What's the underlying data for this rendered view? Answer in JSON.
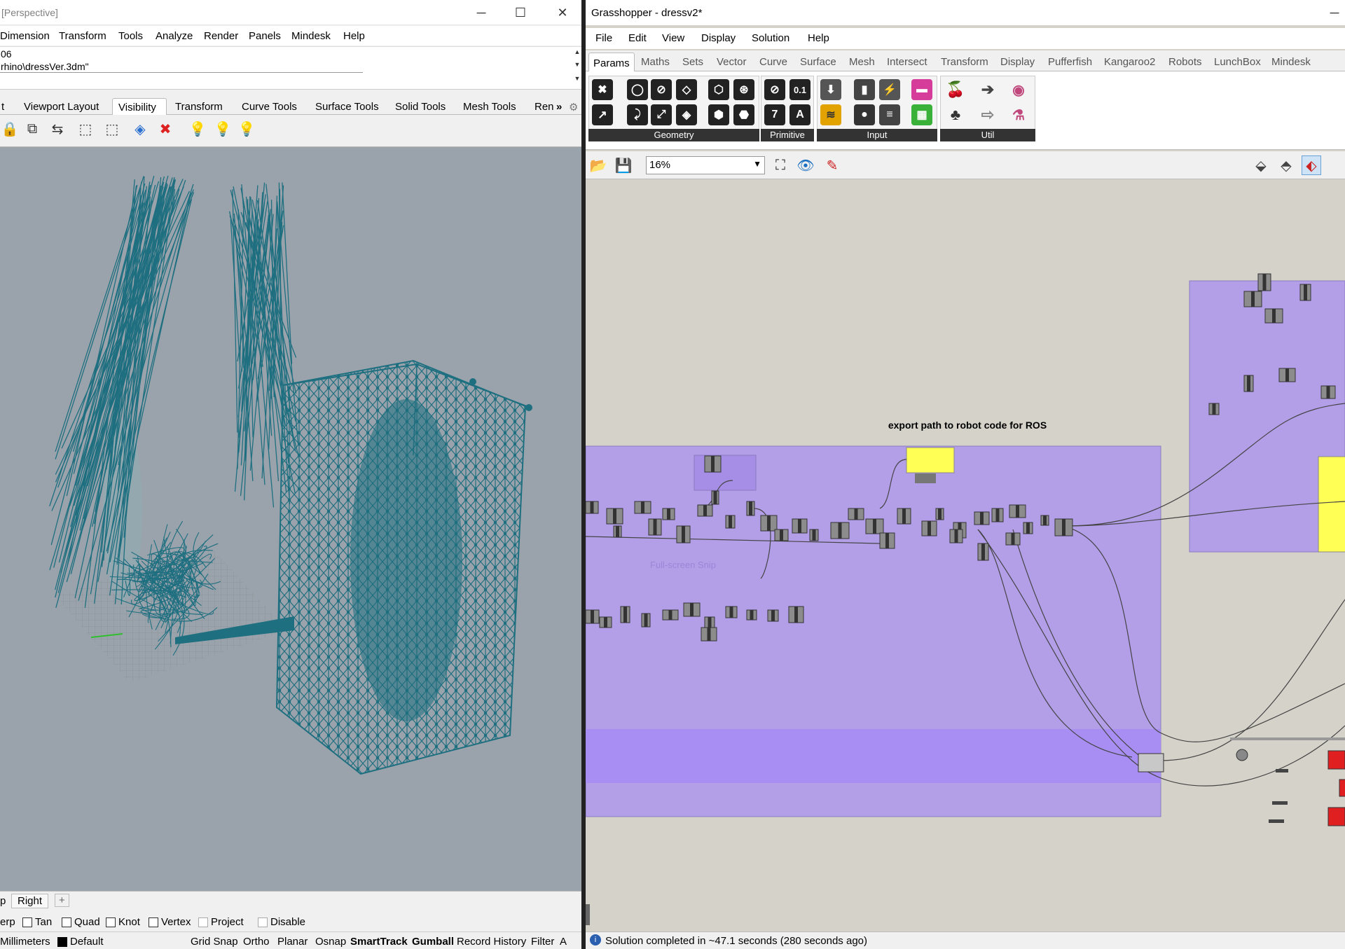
{
  "rhino": {
    "title": "[Perspective]",
    "window_controls": {
      "minimize": "─",
      "maximize": "☐",
      "close": "✕"
    },
    "menu": [
      "Dimension",
      "Transform",
      "Tools",
      "Analyze",
      "Render",
      "Panels",
      "Mindesk",
      "Help"
    ],
    "command_lines": [
      "06",
      "rhino\\dressVer.3dm\""
    ],
    "toolbar_tabs": [
      "t",
      "Viewport Layout",
      "Visibility",
      "Transform",
      "Curve Tools",
      "Surface Tools",
      "Solid Tools",
      "Mesh Tools",
      "Ren"
    ],
    "toolbar_tabs_active": "Visibility",
    "tabs_overflow": "»",
    "viewport_tabs": [
      "p",
      "Right",
      "+"
    ],
    "osnap": [
      {
        "label": "erp",
        "checked": false,
        "box": false
      },
      {
        "label": "Tan",
        "checked": false,
        "box": true
      },
      {
        "label": "Quad",
        "checked": false,
        "box": true
      },
      {
        "label": "Knot",
        "checked": false,
        "box": true
      },
      {
        "label": "Vertex",
        "checked": false,
        "box": true
      },
      {
        "label": "Project",
        "checked": false,
        "box": true,
        "disabled": true
      },
      {
        "label": "Disable",
        "checked": false,
        "box": true,
        "disabled": true
      }
    ],
    "status": {
      "units": "Millimeters",
      "layer": "Default",
      "items": [
        "Grid Snap",
        "Ortho",
        "Planar",
        "Osnap",
        "SmartTrack",
        "Gumball",
        "Record History",
        "Filter",
        "A"
      ]
    },
    "wire_color": "#1e6f80"
  },
  "grasshopper": {
    "title": "Grasshopper - dressv2*",
    "window_controls": {
      "minimize": "─"
    },
    "menu": [
      "File",
      "Edit",
      "View",
      "Display",
      "Solution",
      "Help"
    ],
    "categories": [
      "Params",
      "Maths",
      "Sets",
      "Vector",
      "Curve",
      "Surface",
      "Mesh",
      "Intersect",
      "Transform",
      "Display",
      "Pufferfish",
      "Kangaroo2",
      "Robots",
      "LunchBox",
      "Mindesk"
    ],
    "active_category": "Params",
    "ribbon_groups": [
      "Geometry",
      "Primitive",
      "Input",
      "Util"
    ],
    "primitive_icon_labels": [
      "0.1",
      "7",
      "A"
    ],
    "zoom": "16%",
    "group_label": "export path to robot code for ROS",
    "ghost_text": "Full-screen Snip",
    "status": "Solution completed in ~47.1 seconds (280 seconds ago)",
    "colors": {
      "group": "#b39ee8",
      "group_dark": "#a88ef2",
      "panel": "#ffff55",
      "canvas": "#d5d2ca"
    }
  }
}
